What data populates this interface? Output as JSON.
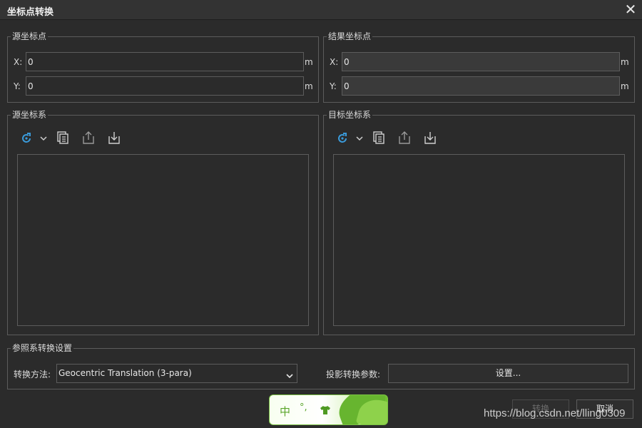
{
  "window": {
    "title": "坐标点转换",
    "close_icon": "close-icon"
  },
  "source_point": {
    "label": "源坐标点",
    "x_label": "X:",
    "x_value": "0",
    "x_unit": "m",
    "y_label": "Y:",
    "y_value": "0",
    "y_unit": "m"
  },
  "result_point": {
    "label": "结果坐标点",
    "x_label": "X:",
    "x_value": "0",
    "x_unit": "m",
    "y_label": "Y:",
    "y_value": "0",
    "y_unit": "m"
  },
  "source_crs": {
    "label": "源坐标系",
    "toolbar": [
      "refresh-icon",
      "chevron-down-icon",
      "copy-icon",
      "export-icon",
      "import-icon"
    ]
  },
  "target_crs": {
    "label": "目标坐标系",
    "toolbar": [
      "refresh-icon",
      "chevron-down-icon",
      "copy-icon",
      "export-icon",
      "import-icon"
    ]
  },
  "reference": {
    "label": "参照系转换设置",
    "method_label": "转换方法:",
    "method_value": "Geocentric Translation (3-para)",
    "param_label": "投影转换参数:",
    "settings_button": "设置..."
  },
  "actions": {
    "convert_button": "转换",
    "cancel_button": "取消"
  },
  "ime": {
    "mode_char": "中",
    "punct": "°,",
    "skin_icon": "shirt-icon"
  },
  "watermark": "https://blog.csdn.net/lling0309",
  "colors": {
    "background": "#2b2b2b",
    "border": "#5c5c5c",
    "accent_icon": "#3a9ad9",
    "ime_green": "#5aa52a"
  }
}
